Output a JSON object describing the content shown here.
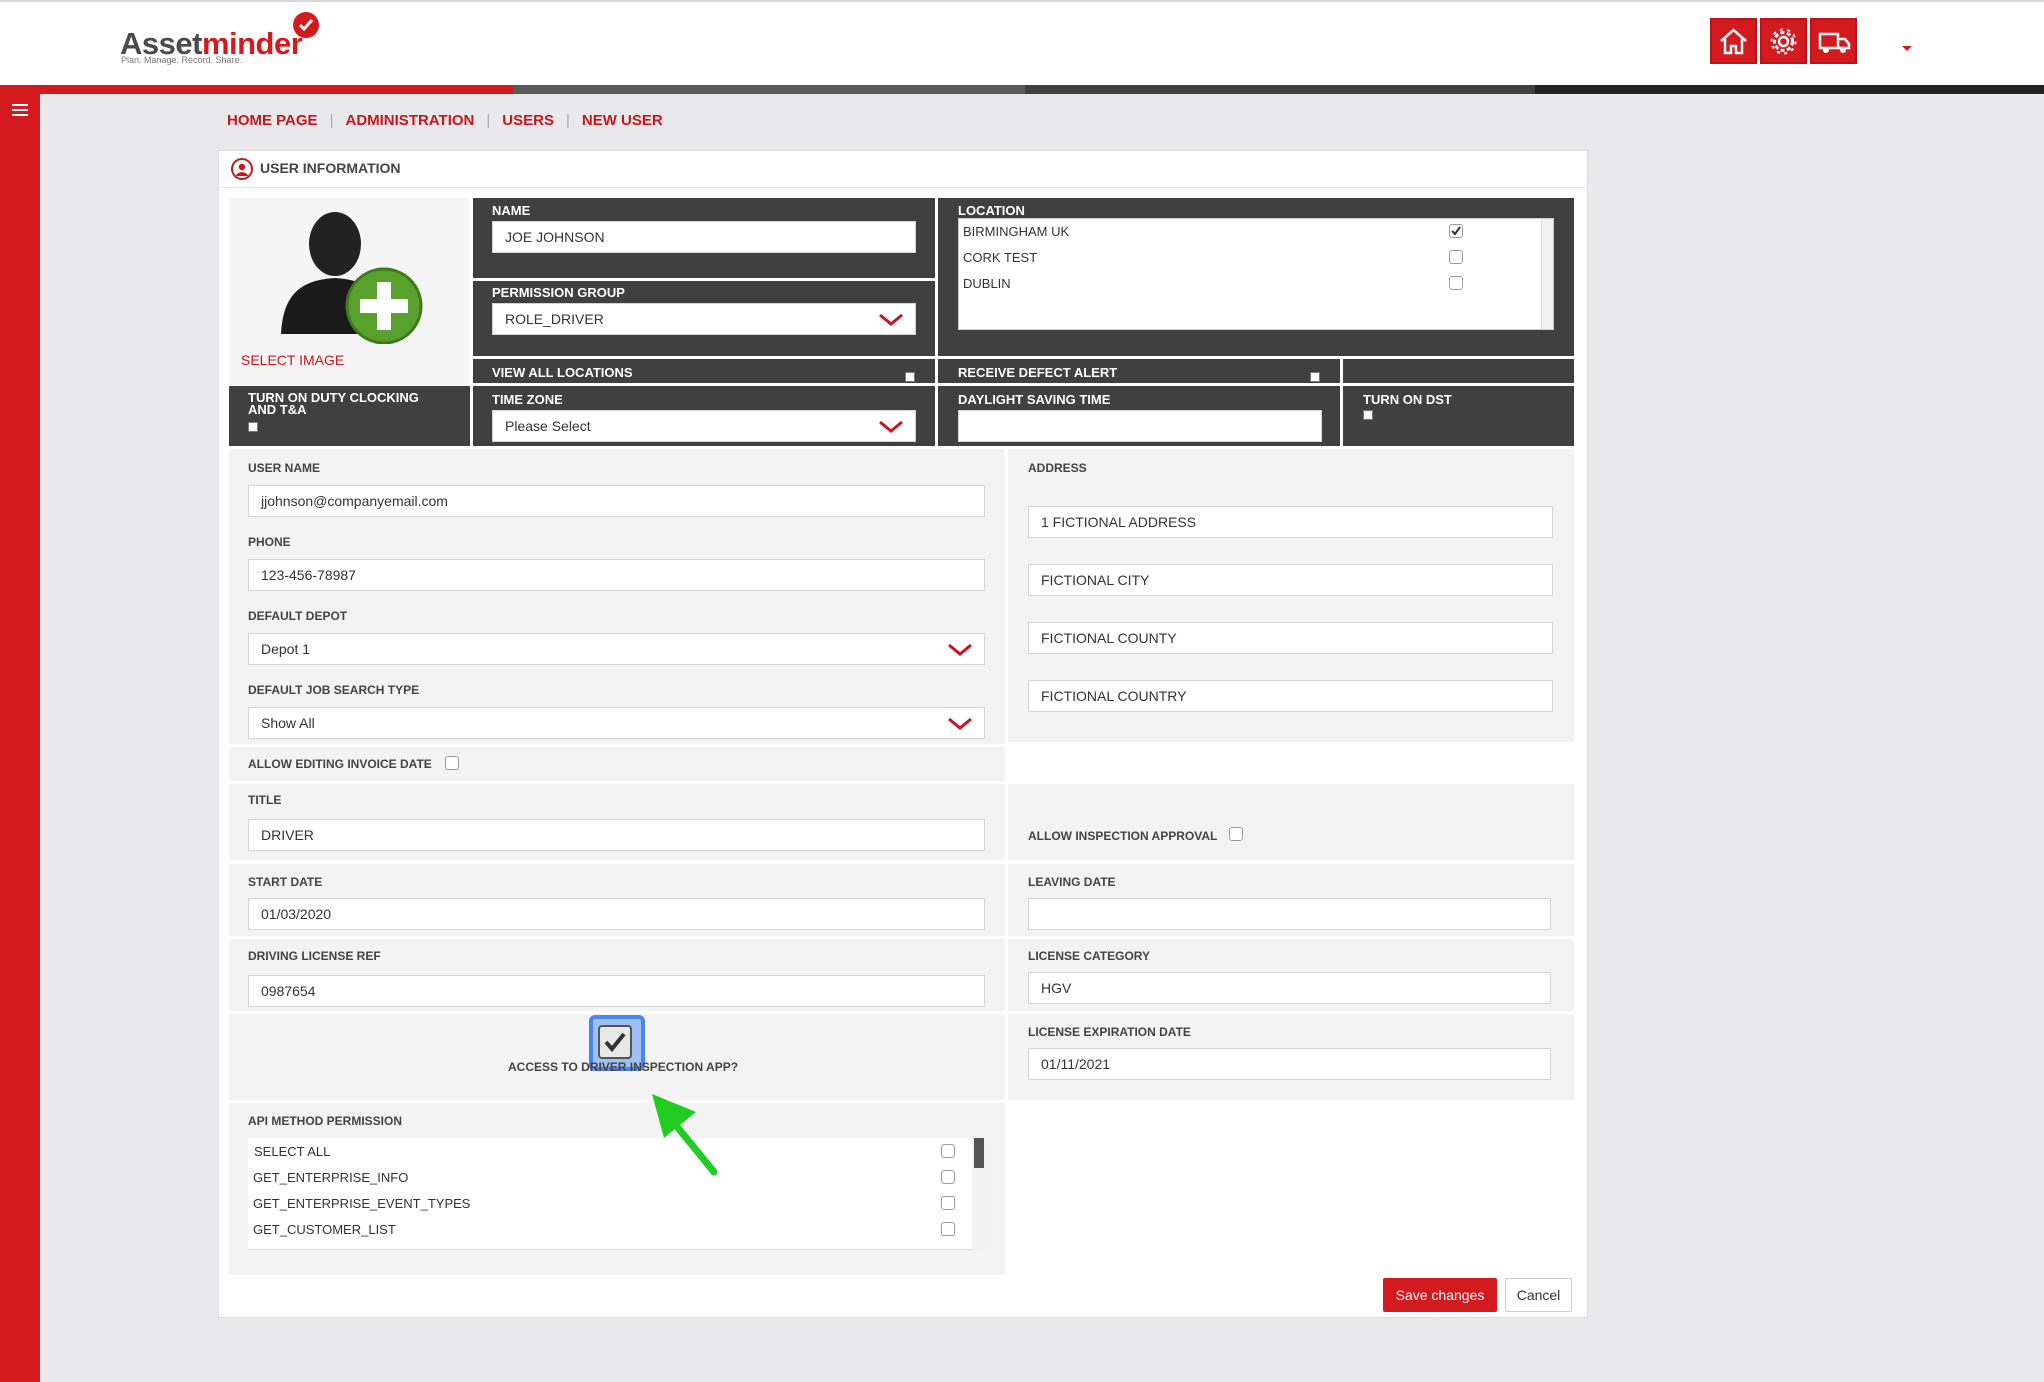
{
  "app": {
    "logo_part1": "Asset",
    "logo_part2": "minder",
    "tagline": "Plan. Manage. Record. Share."
  },
  "header_icons": [
    "home-icon",
    "gear-icon",
    "truck-icon"
  ],
  "colors": {
    "brand": "#d21a1f",
    "dark_panel": "#404040",
    "light_panel": "#f3f3f3",
    "highlight": "#4a86f0",
    "arrow": "#22cc22"
  },
  "breadcrumb": [
    "HOME PAGE",
    "ADMINISTRATION",
    "USERS",
    "NEW USER"
  ],
  "panel": {
    "title": "USER INFORMATION"
  },
  "image": {
    "select_label": "SELECT IMAGE"
  },
  "name": {
    "label": "NAME",
    "value": "JOE JOHNSON"
  },
  "permission_group": {
    "label": "PERMISSION GROUP",
    "value": "ROLE_DRIVER"
  },
  "location": {
    "label": "LOCATION",
    "items": [
      {
        "name": "BIRMINGHAM UK",
        "checked": true
      },
      {
        "name": "CORK TEST",
        "checked": false
      },
      {
        "name": "DUBLIN",
        "checked": false
      }
    ]
  },
  "view_all_locations": {
    "label": "VIEW ALL LOCATIONS",
    "checked": false
  },
  "receive_defect_alert": {
    "label": "RECEIVE DEFECT ALERT",
    "checked": false
  },
  "duty_clocking": {
    "label_line1": "TURN ON DUTY CLOCKING",
    "label_line2": "AND T&A",
    "checked": false
  },
  "time_zone": {
    "label": "TIME ZONE",
    "value": "Please Select"
  },
  "daylight_saving": {
    "label": "DAYLIGHT SAVING TIME",
    "value": ""
  },
  "turn_on_dst": {
    "label": "TURN ON DST",
    "checked": false
  },
  "user_name": {
    "label": "USER NAME",
    "value": "jjohnson@companyemail.com"
  },
  "phone": {
    "label": "PHONE",
    "value": "123-456-78987"
  },
  "default_depot": {
    "label": "DEFAULT DEPOT",
    "value": "Depot 1"
  },
  "default_job_search": {
    "label": "DEFAULT JOB SEARCH TYPE",
    "value": "Show All"
  },
  "allow_editing_invoice": {
    "label": "ALLOW EDITING INVOICE DATE",
    "checked": false
  },
  "title": {
    "label": "TITLE",
    "value": "DRIVER"
  },
  "address": {
    "label": "ADDRESS",
    "line1": "1 FICTIONAL ADDRESS",
    "city": "FICTIONAL CITY",
    "county": "FICTIONAL COUNTY",
    "country": "FICTIONAL COUNTRY"
  },
  "allow_inspection_approval": {
    "label": "ALLOW INSPECTION APPROVAL",
    "checked": false
  },
  "start_date": {
    "label": "START DATE",
    "value": "01/03/2020"
  },
  "leaving_date": {
    "label": "LEAVING DATE",
    "value": ""
  },
  "driving_license": {
    "label": "DRIVING LICENSE REF",
    "value": "0987654"
  },
  "license_category": {
    "label": "LICENSE CATEGORY",
    "value": "HGV"
  },
  "driver_app": {
    "label": "ACCESS TO DRIVER INSPECTION APP?",
    "checked": true
  },
  "license_expiration": {
    "label": "LICENSE EXPIRATION DATE",
    "value": "01/11/2021"
  },
  "api_permission": {
    "label": "API METHOD PERMISSION",
    "items": [
      "SELECT ALL",
      "GET_ENTERPRISE_INFO",
      "GET_ENTERPRISE_EVENT_TYPES",
      "GET_CUSTOMER_LIST"
    ]
  },
  "buttons": {
    "save": "Save changes",
    "cancel": "Cancel"
  }
}
